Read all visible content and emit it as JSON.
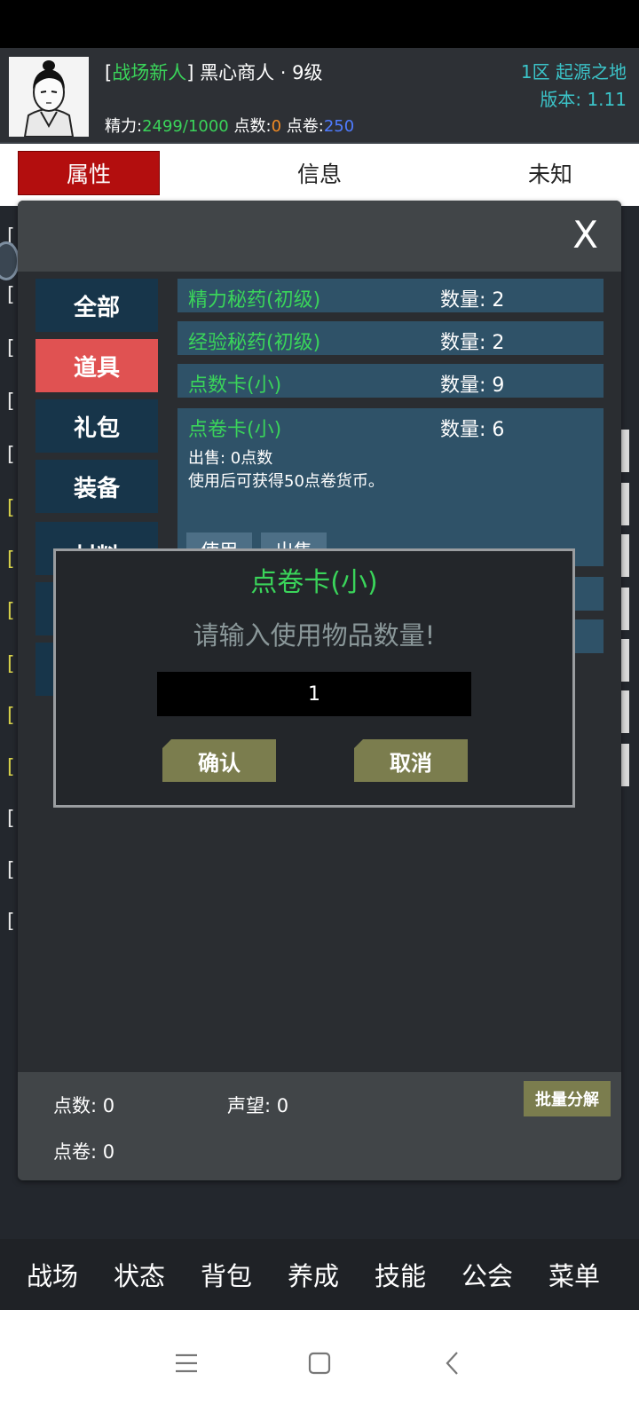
{
  "player": {
    "title_prefix": "[",
    "title": "战场新人",
    "title_suffix": "]",
    "name_level": " 黑心商人 · 9级",
    "energy_label": "精力:",
    "energy_value": "2499/1000",
    "points_label": "点数:",
    "points_value": "0",
    "vouchers_label": "点卷:",
    "vouchers_value": "250"
  },
  "server": {
    "zone": "1区 起源之地",
    "version": "版本: 1.11"
  },
  "top_tabs": [
    "属性",
    "信息",
    "未知"
  ],
  "panel": {
    "close_label": "X",
    "categories": [
      "全部",
      "道具",
      "礼包",
      "装备",
      "材料"
    ],
    "active_category": "道具",
    "items": [
      {
        "name": "精力秘药(初级)",
        "qty": "数量: 2"
      },
      {
        "name": "经验秘药(初级)",
        "qty": "数量: 2"
      },
      {
        "name": "点数卡(小)",
        "qty": "数量: 9"
      },
      {
        "name": "点卷卡(小)",
        "qty": "数量: 6",
        "desc1": "出售: 0点数",
        "desc2": "使用后可获得50点卷货币。",
        "btn_use": "使用",
        "btn_sell": "出售"
      }
    ],
    "footer": {
      "points": "点数: 0",
      "reputation": "声望: 0",
      "vouchers": "点卷: 0",
      "batch_label": "批量分解"
    }
  },
  "dialog": {
    "title": "点卷卡(小)",
    "prompt": "请输入使用物品数量!",
    "input_value": "1",
    "confirm": "确认",
    "cancel": "取消"
  },
  "bottom_nav": [
    "战场",
    "状态",
    "背包",
    "养成",
    "技能",
    "公会",
    "菜单"
  ],
  "colors": {
    "accent_green": "#3ad45a",
    "active_tab_red": "#b30e0e",
    "active_category": "#e05252",
    "button_olive": "#7b7d4e",
    "server_cyan": "#3bc4c9"
  }
}
